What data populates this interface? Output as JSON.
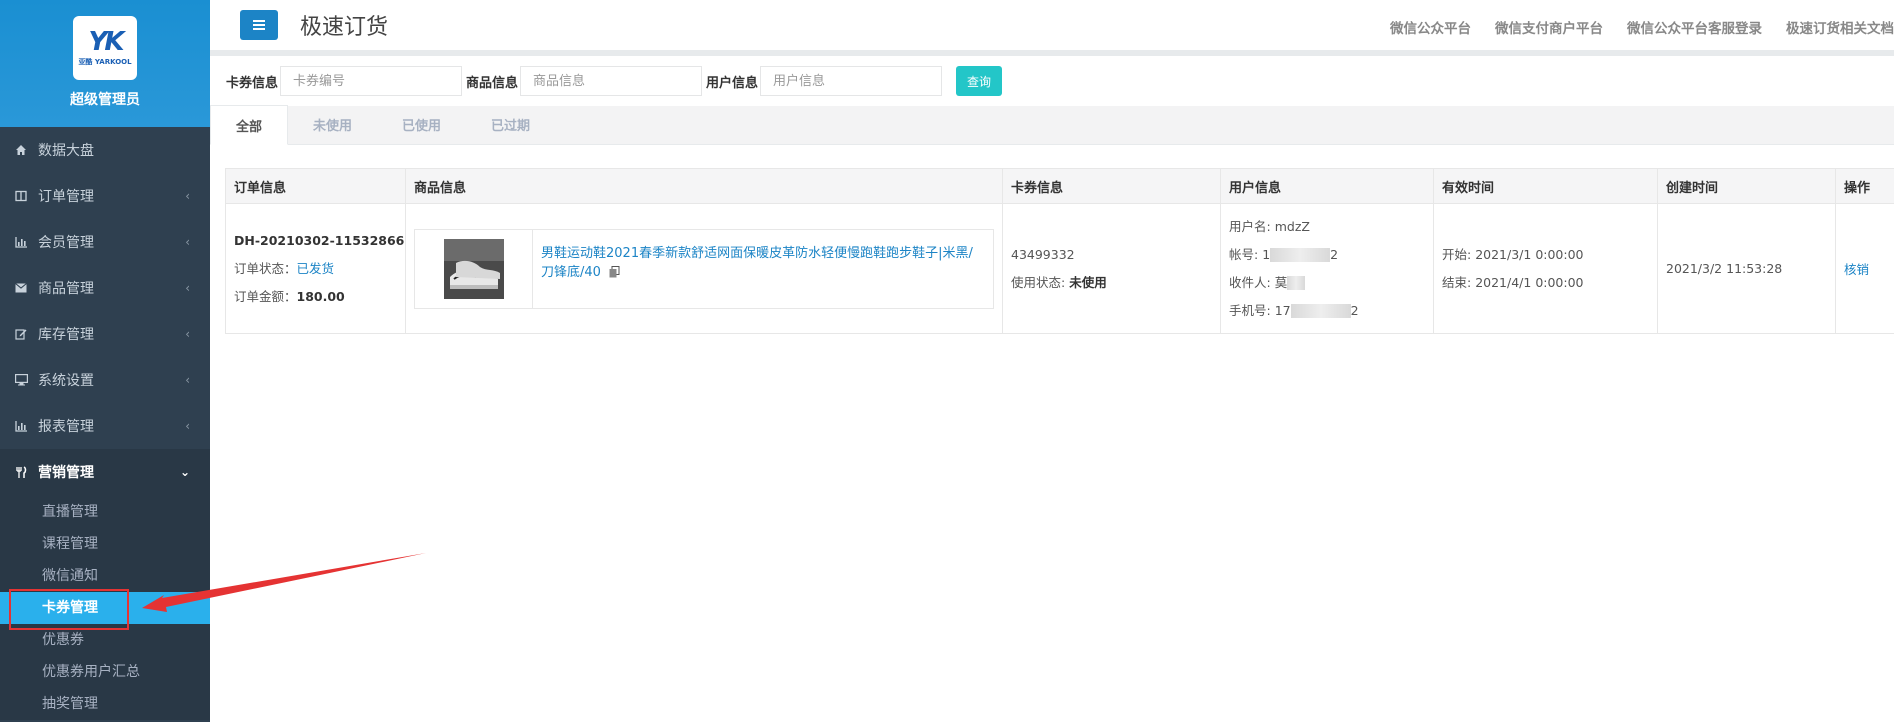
{
  "sidebar": {
    "logo_mark": "YK",
    "logo_sub": "亚酷 YARKOOL",
    "role": "超级管理员",
    "items": [
      {
        "label": "数据大盘",
        "icon": "home-icon"
      },
      {
        "label": "订单管理",
        "icon": "columns-icon"
      },
      {
        "label": "会员管理",
        "icon": "bar-chart-icon"
      },
      {
        "label": "商品管理",
        "icon": "envelope-icon"
      },
      {
        "label": "库存管理",
        "icon": "edit-icon"
      },
      {
        "label": "系统设置",
        "icon": "desktop-icon"
      },
      {
        "label": "报表管理",
        "icon": "bar-chart-icon"
      },
      {
        "label": "营销管理",
        "icon": "cutlery-icon"
      }
    ],
    "sub_items": [
      "直播管理",
      "课程管理",
      "微信通知",
      "卡券管理",
      "优惠券",
      "优惠券用户汇总",
      "抽奖管理"
    ]
  },
  "header": {
    "title": "极速订货",
    "links": [
      "微信公众平台",
      "微信支付商户平台",
      "微信公众平台客服登录",
      "极速订货相关文档"
    ]
  },
  "search": {
    "card_label": "卡券信息",
    "card_placeholder": "卡券编号",
    "goods_label": "商品信息",
    "goods_placeholder": "商品信息",
    "user_label": "用户信息",
    "user_placeholder": "用户信息",
    "query_label": "查询"
  },
  "tabs": [
    "全部",
    "未使用",
    "已使用",
    "已过期"
  ],
  "table": {
    "headers": [
      "订单信息",
      "商品信息",
      "卡券信息",
      "用户信息",
      "有效时间",
      "创建时间",
      "操作"
    ],
    "row": {
      "order_no": "DH-20210302-11532866",
      "status_label": "订单状态：",
      "status_value": "已发货",
      "amount_label": "订单金额：",
      "amount_value": "180.00",
      "goods_title": "男鞋运动鞋2021春季新款舒适网面保暖皮革防水轻便慢跑鞋跑步鞋子|米黑/刀锋底/40",
      "card_no": "43499332",
      "use_status_label": "使用状态:",
      "use_status_value": "未使用",
      "username_label": "用户名:",
      "username_value": "mdzZ",
      "account_label": "帐号:",
      "account_prefix": "1",
      "account_suffix": "2",
      "receiver_label": "收件人:",
      "receiver_prefix": "莫",
      "phone_label": "手机号:",
      "phone_prefix": "17",
      "phone_suffix": "2",
      "start_label": "开始:",
      "start_value": "2021/3/1 0:00:00",
      "end_label": "结束:",
      "end_value": "2021/4/1 0:00:00",
      "created": "2021/3/2 11:53:28",
      "action": "核销"
    }
  },
  "colors": {
    "sidebar_bg": "#2f4050",
    "profile_bg": "#1a8fd2",
    "active_sub": "#2ab0ec",
    "primary": "#1c84c6",
    "query_btn": "#23c6c8",
    "annotation": "#e53333"
  }
}
